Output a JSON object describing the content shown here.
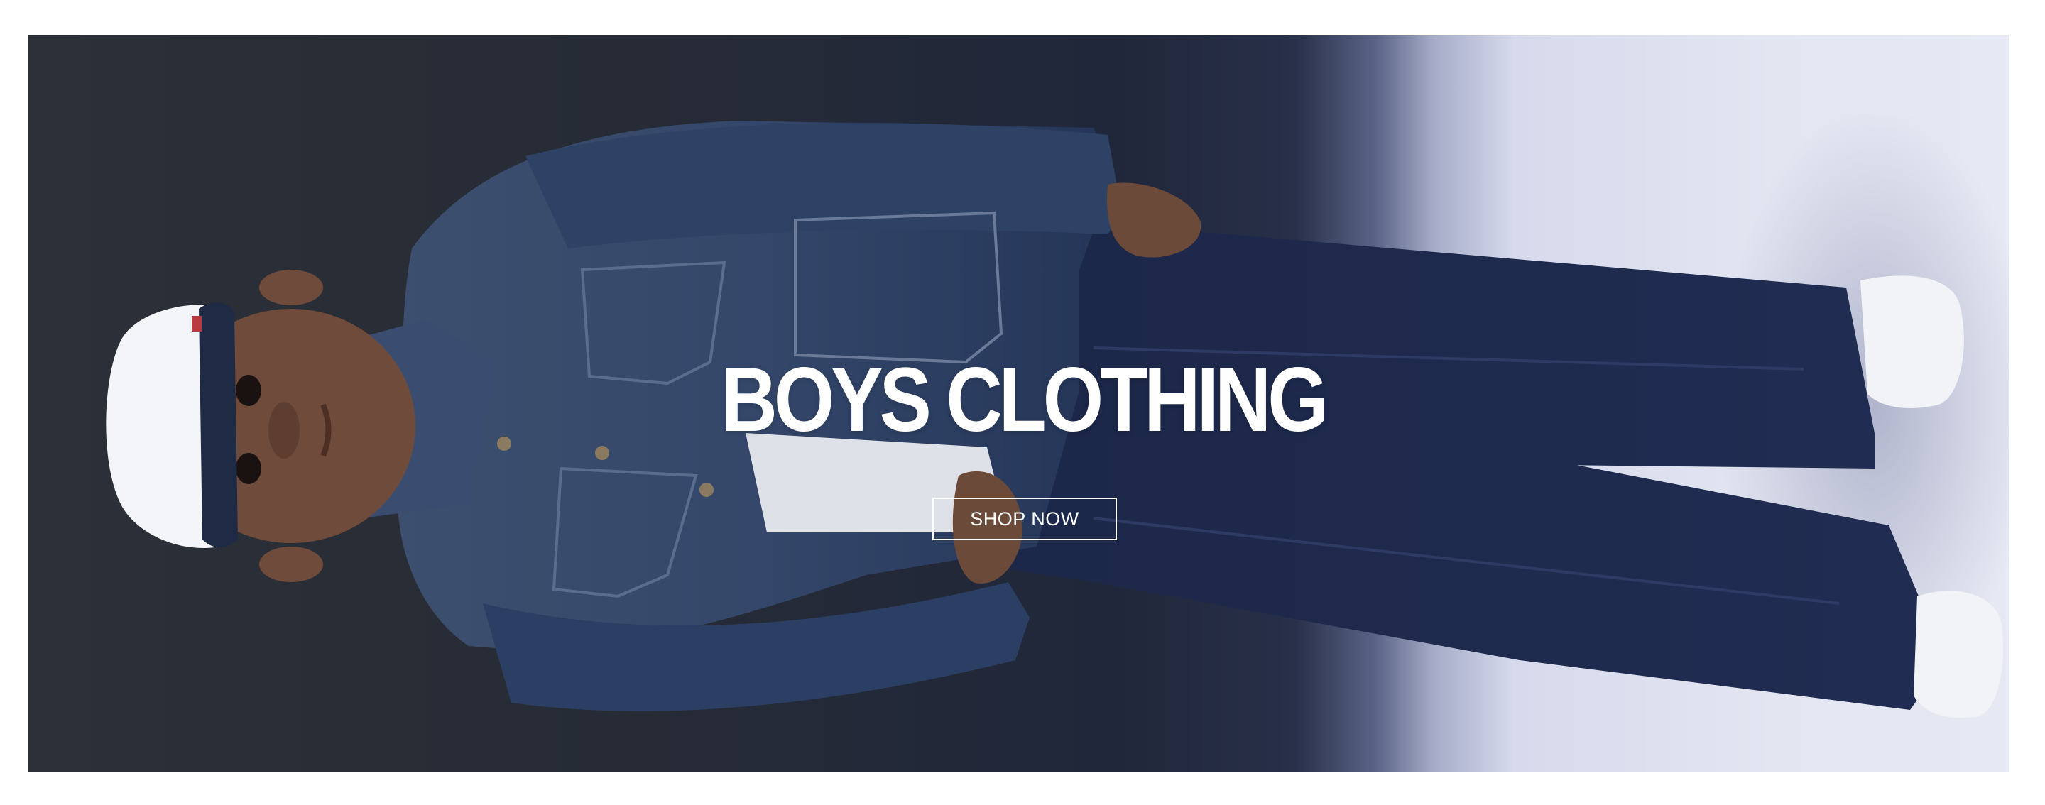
{
  "hero": {
    "title": "BOYS CLOTHING",
    "cta_label": "SHOP NOW",
    "image_description_icon": "boy-in-denim-outfit-image"
  },
  "colors": {
    "background_dark": "#262b35",
    "background_light": "#e3e5f1",
    "denim": "#1e2c4a",
    "text": "#ffffff"
  }
}
